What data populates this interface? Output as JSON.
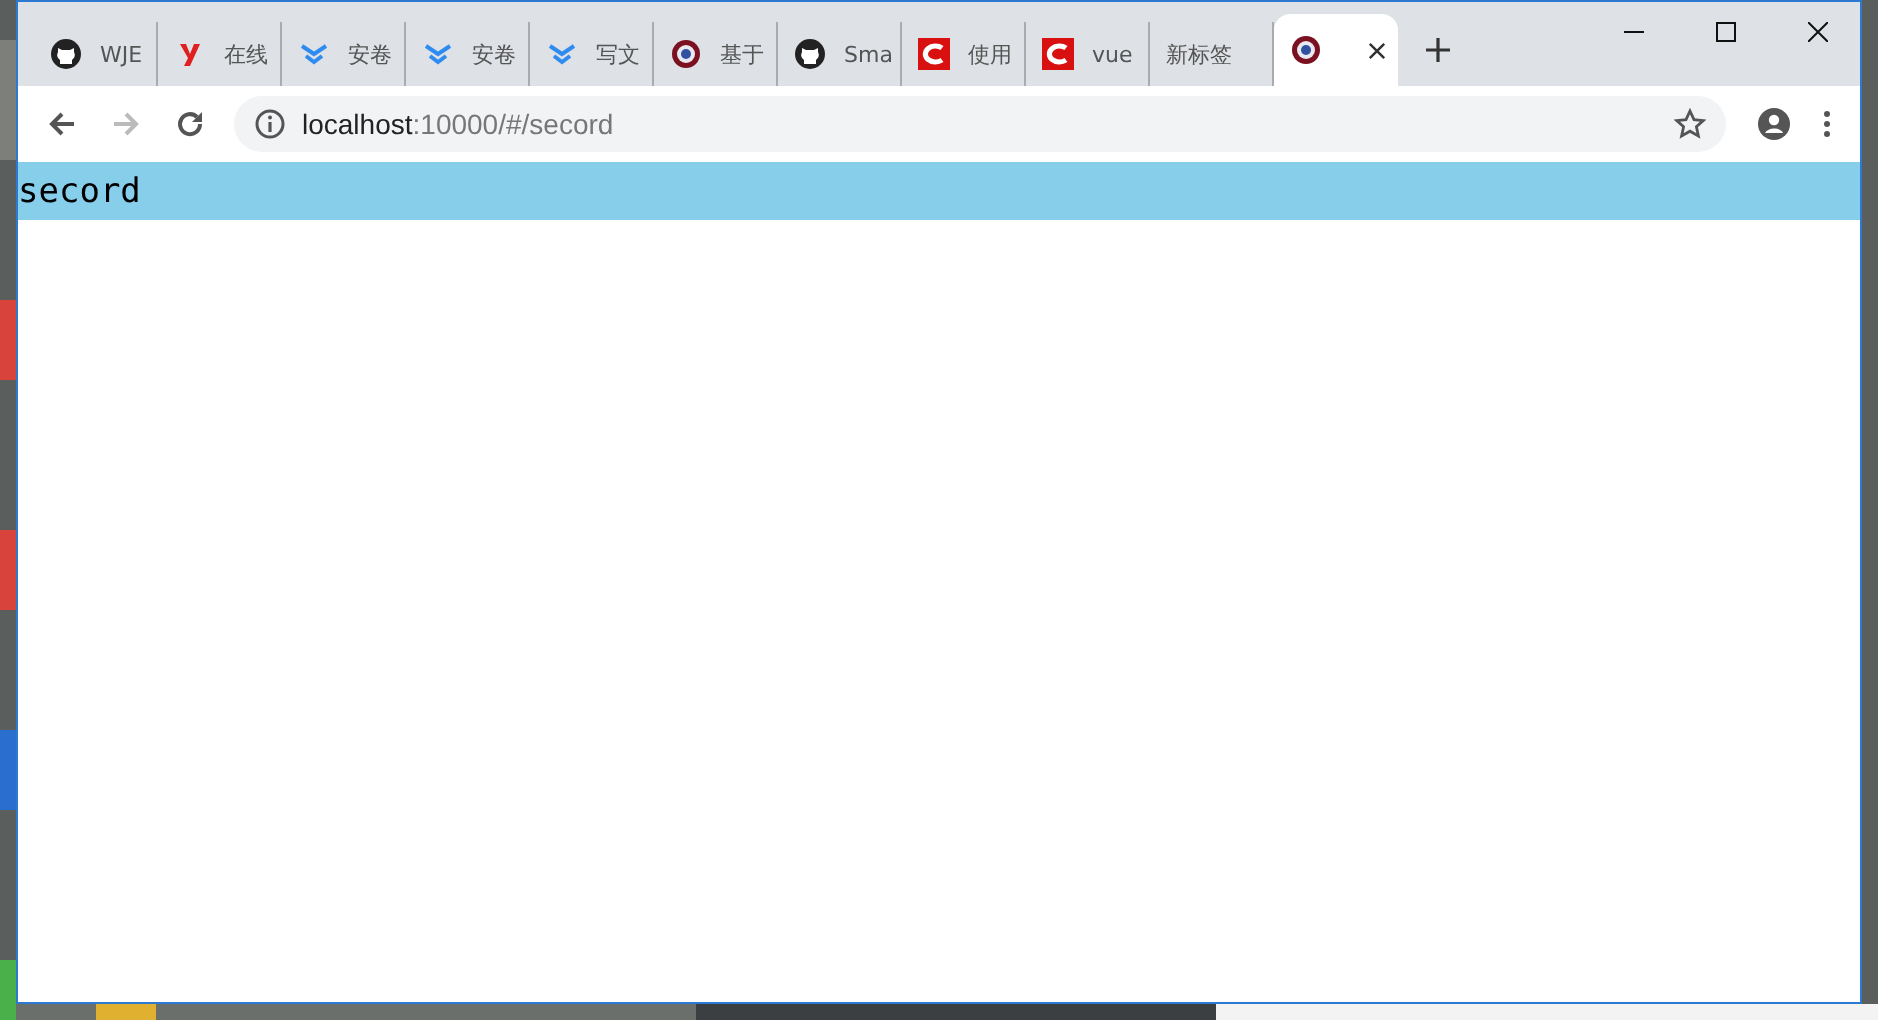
{
  "tabs": [
    {
      "title": "WJE",
      "kind": "github",
      "selected": false
    },
    {
      "title": "在线",
      "kind": "yuque",
      "selected": false
    },
    {
      "title": "安卷",
      "kind": "chevron",
      "selected": false
    },
    {
      "title": "安卷",
      "kind": "chevron",
      "selected": false
    },
    {
      "title": "写文",
      "kind": "chevron",
      "selected": false
    },
    {
      "title": "基于",
      "kind": "shield",
      "selected": false
    },
    {
      "title": "Sma",
      "kind": "github",
      "selected": false
    },
    {
      "title": "使用",
      "kind": "csdn",
      "selected": false
    },
    {
      "title": "vue",
      "kind": "csdn",
      "selected": false
    },
    {
      "title": "新标签",
      "kind": "plain",
      "selected": false
    },
    {
      "kind": "shield",
      "selected": true
    }
  ],
  "address": {
    "host": "localhost",
    "rest": ":10000/#/secord"
  },
  "page": {
    "heading": "secord"
  }
}
